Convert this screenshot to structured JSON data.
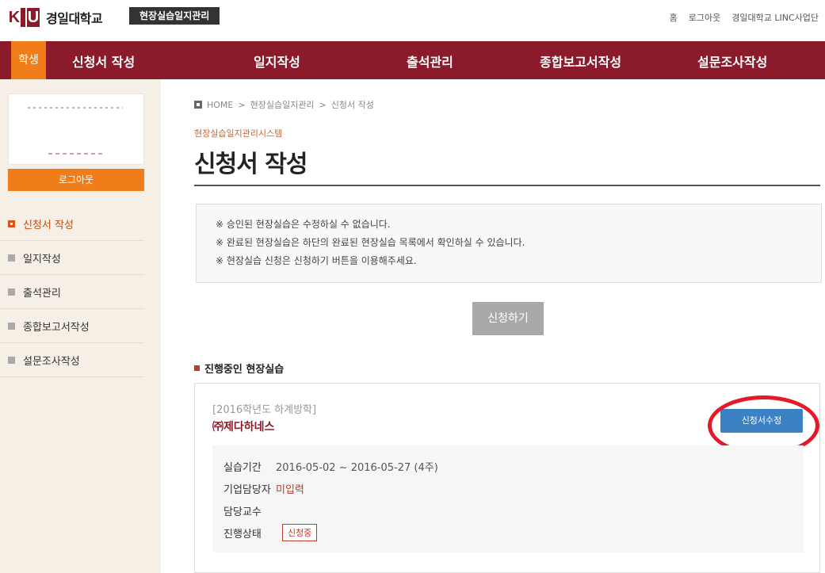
{
  "header": {
    "logo_letters": [
      "K",
      "I",
      "U"
    ],
    "university_name": "경일대학교",
    "system_badge": "현장실습일지관리",
    "utility_links": [
      "홈",
      "로그아웃",
      "경일대학교 LINC사업단"
    ]
  },
  "nav": {
    "role_label": "학생",
    "items": [
      "신청서 작성",
      "일지작성",
      "출석관리",
      "종합보고서작성",
      "설문조사작성"
    ]
  },
  "sidebar": {
    "logout_label": "로그아웃",
    "items": [
      {
        "label": "신청서 작성",
        "active": true
      },
      {
        "label": "일지작성",
        "active": false
      },
      {
        "label": "출석관리",
        "active": false
      },
      {
        "label": "종합보고서작성",
        "active": false
      },
      {
        "label": "설문조사작성",
        "active": false
      }
    ]
  },
  "breadcrumb": {
    "home": "HOME",
    "items": [
      "현장실습일지관리",
      "신청서 작성"
    ],
    "separator": ">"
  },
  "page": {
    "system_name": "현장실습일지관리시스템",
    "title": "신청서 작성"
  },
  "notice": [
    "※ 승인된 현장실습은 수정하실 수 없습니다.",
    "※ 완료된 현장실습은 하단의 완료된 현장실습 목록에서 확인하실 수 있습니다.",
    "※ 현장실습 신청은 신청하기 버튼을 이용해주세요."
  ],
  "apply_button": "신청하기",
  "section": {
    "title": "진행중인 현장실습"
  },
  "internship": {
    "term": "[2016학년도 하계방학]",
    "company": "㈜제다하네스",
    "edit_button": "신청서수정",
    "period_label": "실습기간",
    "period_value": "2016-05-02 ~ 2016-05-27 (4주)",
    "manager_label": "기업담당자",
    "manager_value": "미입력",
    "professor_label": "담당교수",
    "professor_value": "",
    "status_label": "진행상태",
    "status_value": "신청중"
  },
  "colors": {
    "brand": "#8b1a2b",
    "accent": "#f07d1a",
    "edit_button": "#3a82c4",
    "highlight": "#e6192a"
  }
}
